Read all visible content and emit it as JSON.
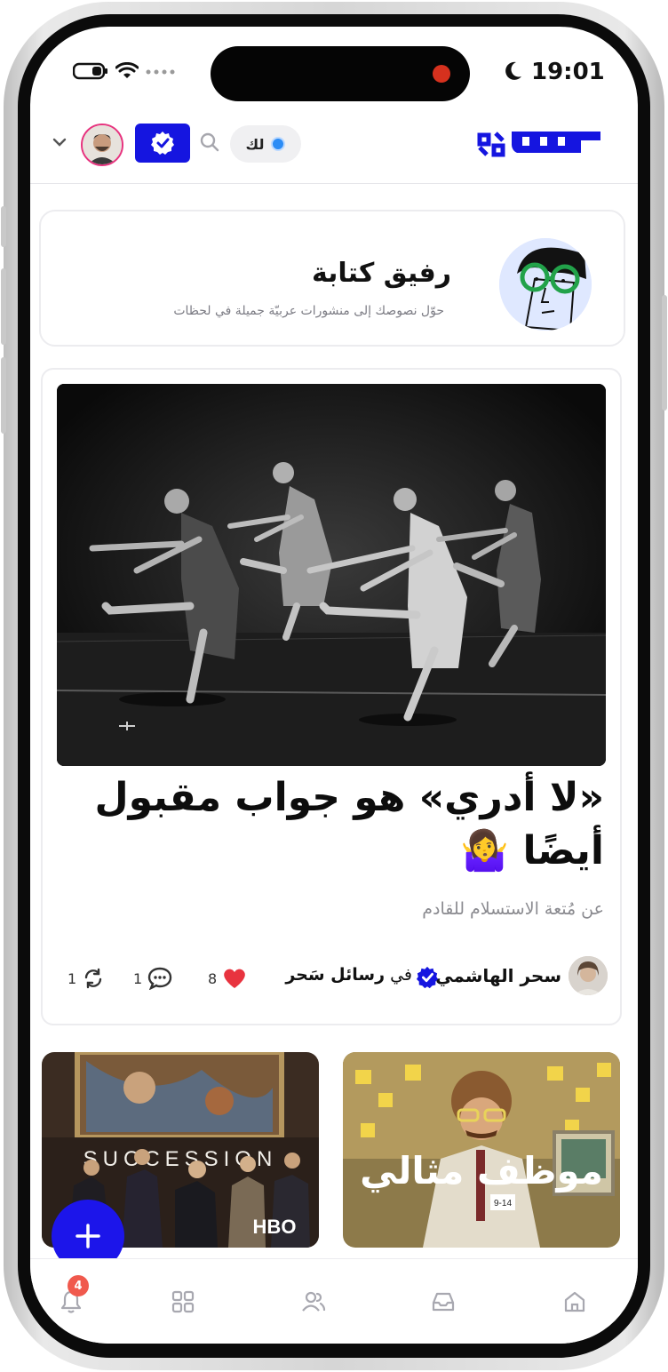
{
  "status_bar": {
    "time": "19:01"
  },
  "header": {
    "logo_text": "كتابة",
    "language_pill": "لك",
    "verified_button_label": "verified"
  },
  "companion": {
    "title": "رفيق كتابة",
    "subtitle": "حوّل نصوصك إلى منشورات عربيّة جميلة في لحظات"
  },
  "article": {
    "title": "«لا أدري» هو جواب مقبول أيضًا 🤷‍♀️",
    "subtitle": "عن مُتعة الاستسلام للقادم",
    "author": "سحر الهاشمي",
    "publication_prefix": "في",
    "publication": "رسائل سَحر",
    "likes": "8",
    "comments": "1",
    "reposts": "1"
  },
  "cards": [
    {
      "overlay_text": "SUCCESSION",
      "brand": "HBO"
    },
    {
      "overlay_text": "موظف مثالي",
      "tag": "9-14"
    }
  ],
  "tabbar": {
    "notifications_count": "4"
  },
  "colors": {
    "brand_blue": "#1515e0",
    "like_red": "#e8333f",
    "badge_red": "#f0594d"
  }
}
